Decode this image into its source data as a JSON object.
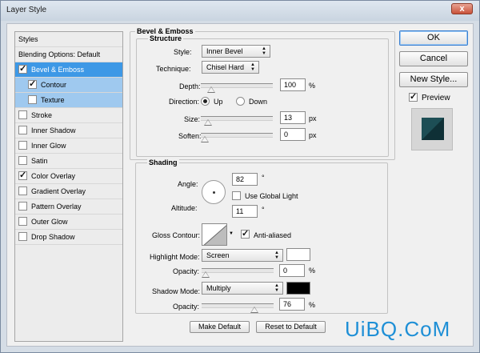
{
  "window": {
    "title": "Layer Style",
    "close_glyph": "x"
  },
  "style_list": {
    "header": "Styles",
    "blending_options": "Blending Options: Default",
    "items": [
      {
        "label": "Bevel & Emboss",
        "checked": true,
        "state": "selected"
      },
      {
        "label": "Contour",
        "checked": true,
        "state": "sub"
      },
      {
        "label": "Texture",
        "checked": false,
        "state": "sub"
      },
      {
        "label": "Stroke",
        "checked": false
      },
      {
        "label": "Inner Shadow",
        "checked": false
      },
      {
        "label": "Inner Glow",
        "checked": false
      },
      {
        "label": "Satin",
        "checked": false
      },
      {
        "label": "Color Overlay",
        "checked": true
      },
      {
        "label": "Gradient Overlay",
        "checked": false
      },
      {
        "label": "Pattern Overlay",
        "checked": false
      },
      {
        "label": "Outer Glow",
        "checked": false
      },
      {
        "label": "Drop Shadow",
        "checked": false
      }
    ]
  },
  "bevel": {
    "section_title": "Bevel & Emboss",
    "structure_title": "Structure",
    "style_label": "Style:",
    "style_value": "Inner Bevel",
    "technique_label": "Technique:",
    "technique_value": "Chisel Hard",
    "depth_label": "Depth:",
    "depth_value": "100",
    "depth_unit": "%",
    "depth_level": 0.1,
    "direction_label": "Direction:",
    "direction_up": "Up",
    "direction_down": "Down",
    "size_label": "Size:",
    "size_value": "13",
    "size_unit": "px",
    "size_level": 0.05,
    "soften_label": "Soften:",
    "soften_value": "0",
    "soften_unit": "px",
    "soften_level": 0.0
  },
  "shading": {
    "title": "Shading",
    "angle_label": "Angle:",
    "angle_value": "82",
    "angle_unit": "°",
    "global_light_label": "Use Global Light",
    "altitude_label": "Altitude:",
    "altitude_value": "11",
    "altitude_unit": "°",
    "gloss_contour_label": "Gloss Contour:",
    "anti_aliased_label": "Anti-aliased",
    "highlight_mode_label": "Highlight Mode:",
    "highlight_mode_value": "Screen",
    "highlight_color": "#ffffff",
    "highlight_opacity_label": "Opacity:",
    "highlight_opacity_value": "0",
    "highlight_opacity_unit": "%",
    "highlight_opacity_level": 0.0,
    "shadow_mode_label": "Shadow Mode:",
    "shadow_mode_value": "Multiply",
    "shadow_color": "#000000",
    "shadow_opacity_label": "Opacity:",
    "shadow_opacity_value": "76",
    "shadow_opacity_unit": "%",
    "shadow_opacity_level": 0.76
  },
  "bottom_buttons": {
    "make_default": "Make Default",
    "reset_default": "Reset to Default"
  },
  "side_buttons": {
    "ok": "OK",
    "cancel": "Cancel",
    "new_style": "New Style...",
    "preview_label": "Preview"
  },
  "preview": {
    "fill_color": "#1d4e55"
  },
  "watermark": "UiBQ.CoM"
}
